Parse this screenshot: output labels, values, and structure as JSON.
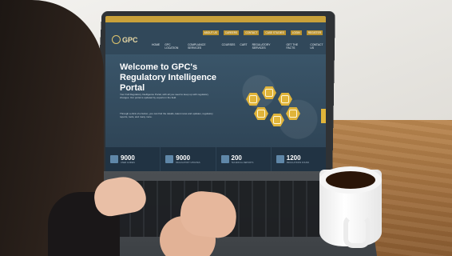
{
  "site": {
    "logo_text": "GPC",
    "top_links": [
      "ABOUT US",
      "CAREERS",
      "CONTACT",
      "CASE STUDIES",
      "LOGIN",
      "REGISTER"
    ],
    "nav_links": [
      "HOME",
      "GPC LOCATION",
      "COMPLIANCE SERVICES",
      "COURSES",
      "CART",
      "REGULATORY SERVICES",
      "GET THE FACTS",
      "CONTACT US"
    ],
    "hero_title": "Welcome to GPC's Regulatory Intelligence Portal",
    "hero_text": "Your Full Regulatory Intelligence Portal, with all you need to keep up with regulatory changes. Our portal is updated by experts in the field.",
    "hero_text2": "Through a click of a button, you can find the details, latest news and updates, regulatory reports, tools, and many more.",
    "stats": [
      {
        "number": "9000",
        "label": "USER GUIDES"
      },
      {
        "number": "9000",
        "label": "REGULATORY UPDATES"
      },
      {
        "number": "200",
        "label": "TECHNICAL REPORTS"
      },
      {
        "number": "1200",
        "label": "REGULATIONS FOUND"
      }
    ]
  },
  "colors": {
    "navy": "#253949",
    "gold": "#e0b43a",
    "hero": "#3a5569"
  }
}
